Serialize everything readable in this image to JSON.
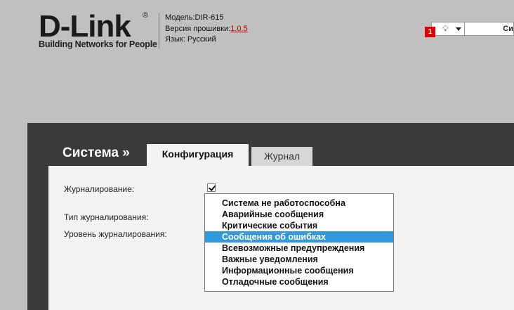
{
  "header": {
    "logo_text": "D-Link",
    "logo_registered": "®",
    "logo_tagline": "Building Networks for People",
    "model": "Модель:DIR-615",
    "firmware_label": "Версия прошивки:",
    "firmware_version": "1.0.5",
    "language": "Язык: Русский"
  },
  "topbar": {
    "notifications_count": "1",
    "notifications_icon": "bulb-icon",
    "system_button_label": "Си"
  },
  "nav": {
    "section_title": "Система »",
    "tabs": [
      {
        "label": "Конфигурация",
        "active": true
      },
      {
        "label": "Журнал",
        "active": false
      }
    ]
  },
  "form": {
    "logging_label": "Журналирование:",
    "logging_enabled": true,
    "log_type_label": "Тип журналирования:",
    "log_level_label": "Уровень журналирования:"
  },
  "dropdown": {
    "options": [
      "Система не работоспособна",
      "Аварийные сообщения",
      "Критические события",
      "Сообщения об ошибках",
      "Всевозможные предупреждения",
      "Важные уведомления",
      "Информационные сообщения",
      "Отладочные сообщения"
    ],
    "highlighted_index": 3
  },
  "colors": {
    "page_bg": "#c0c0c0",
    "panel_bg": "#3a3a3a",
    "content_bg": "#f2f2f2",
    "highlight": "#3399dd",
    "badge": "#e00000",
    "version_link": "#c00000"
  }
}
